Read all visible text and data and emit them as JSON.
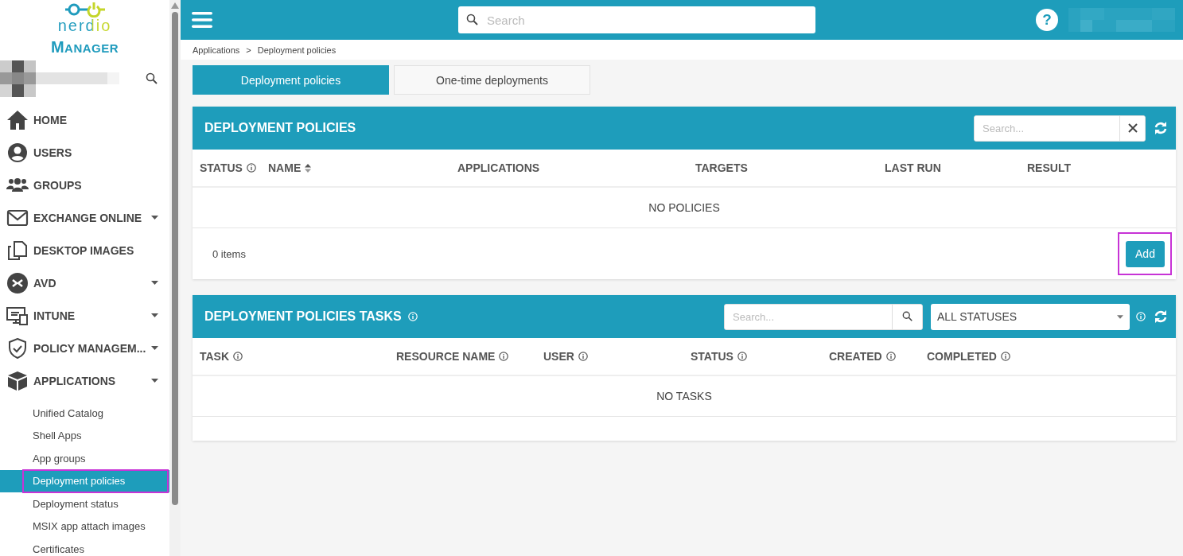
{
  "brand": {
    "logo": "nerdio",
    "product": "MANAGER"
  },
  "header": {
    "search_placeholder": "Search",
    "help": "?"
  },
  "sidebar": {
    "items": [
      {
        "label": "HOME",
        "kind": "home",
        "expandable": false
      },
      {
        "label": "USERS",
        "kind": "user",
        "expandable": false
      },
      {
        "label": "GROUPS",
        "kind": "group",
        "expandable": false
      },
      {
        "label": "EXCHANGE ONLINE",
        "kind": "mail",
        "expandable": true
      },
      {
        "label": "DESKTOP IMAGES",
        "kind": "copy",
        "expandable": false
      },
      {
        "label": "AVD",
        "kind": "avd",
        "expandable": true
      },
      {
        "label": "INTUNE",
        "kind": "monitor",
        "expandable": true
      },
      {
        "label": "POLICY MANAGEM...",
        "kind": "shield",
        "expandable": true
      },
      {
        "label": "APPLICATIONS",
        "kind": "box",
        "expandable": true,
        "children": [
          {
            "label": "Unified Catalog",
            "selected": false,
            "highlighted": false
          },
          {
            "label": "Shell Apps",
            "selected": false,
            "highlighted": false
          },
          {
            "label": "App groups",
            "selected": false,
            "highlighted": false
          },
          {
            "label": "Deployment policies",
            "selected": true,
            "highlighted": true
          },
          {
            "label": "Deployment status",
            "selected": false,
            "highlighted": false
          },
          {
            "label": "MSIX app attach images",
            "selected": false,
            "highlighted": false
          },
          {
            "label": "Certificates",
            "selected": false,
            "highlighted": false
          }
        ]
      }
    ]
  },
  "breadcrumb": [
    "Applications",
    "Deployment policies"
  ],
  "breadcrumb_separator": ">",
  "tabs": [
    {
      "label": "Deployment policies",
      "selected": true
    },
    {
      "label": "One-time deployments",
      "selected": false
    }
  ],
  "policies_panel": {
    "title": "DEPLOYMENT POLICIES",
    "search_placeholder": "Search...",
    "columns": [
      {
        "label": "STATUS",
        "info": true,
        "sorted": false
      },
      {
        "label": "NAME",
        "info": false,
        "sorted": true
      },
      {
        "label": "APPLICATIONS",
        "info": false,
        "sorted": false
      },
      {
        "label": "TARGETS",
        "info": false,
        "sorted": false
      },
      {
        "label": "LAST RUN",
        "info": false,
        "sorted": false
      },
      {
        "label": "RESULT",
        "info": false,
        "sorted": false
      }
    ],
    "empty_message": "NO POLICIES",
    "item_count": "0 items",
    "add_button": {
      "label": "Add",
      "highlighted": true
    }
  },
  "tasks_panel": {
    "title": "DEPLOYMENT POLICIES TASKS",
    "info": true,
    "search_placeholder": "Search...",
    "status_filter": "ALL STATUSES",
    "columns": [
      {
        "label": "TASK",
        "info": true
      },
      {
        "label": "RESOURCE NAME",
        "info": true
      },
      {
        "label": "USER",
        "info": true
      },
      {
        "label": "STATUS",
        "info": true
      },
      {
        "label": "CREATED",
        "info": true
      },
      {
        "label": "COMPLETED",
        "info": true
      }
    ],
    "empty_message": "NO TASKS"
  }
}
